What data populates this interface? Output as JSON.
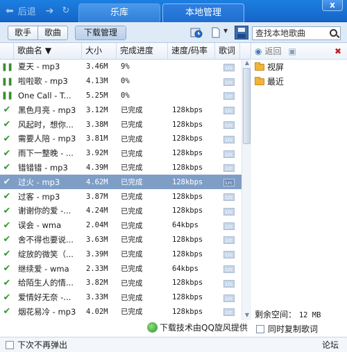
{
  "nav": {
    "back_label": "后退"
  },
  "tabs": [
    {
      "label": "乐库"
    },
    {
      "label": "本地管理"
    }
  ],
  "window": {
    "close_label": "x"
  },
  "toolbar": {
    "singer_label": "歌手",
    "song_label": "歌曲",
    "download_label": "下载管理",
    "search_placeholder": "查找本地歌曲"
  },
  "table": {
    "headers": {
      "name": "歌曲名 ▼",
      "size": "大小",
      "progress": "完成进度",
      "speed": "速度/码率",
      "lyric": "歌词"
    },
    "rows": [
      {
        "status": "pause",
        "name": "夏天 - mp3",
        "size": "3.46M",
        "progress": "9%",
        "speed": "",
        "lyric": "Lrc"
      },
      {
        "status": "pause",
        "name": "啦啦歌 - mp3",
        "size": "4.13M",
        "progress": "0%",
        "speed": "",
        "lyric": "Lrc"
      },
      {
        "status": "pause",
        "name": "One Call - T...",
        "size": "5.25M",
        "progress": "0%",
        "speed": "",
        "lyric": "Lrc"
      },
      {
        "status": "done",
        "name": "黑色月亮 - mp3",
        "size": "3.12M",
        "progress": "已完成",
        "speed": "128kbps",
        "lyric": "Lrc"
      },
      {
        "status": "done",
        "name": "风起时，想你...",
        "size": "3.38M",
        "progress": "已完成",
        "speed": "128kbps",
        "lyric": "Lrc"
      },
      {
        "status": "done",
        "name": "需要人陪 - mp3",
        "size": "3.81M",
        "progress": "已完成",
        "speed": "128kbps",
        "lyric": "Lrc"
      },
      {
        "status": "done",
        "name": "雨下一整晚 - ...",
        "size": "3.92M",
        "progress": "已完成",
        "speed": "128kbps",
        "lyric": "Lrc"
      },
      {
        "status": "done",
        "name": "错错错 - mp3",
        "size": "4.39M",
        "progress": "已完成",
        "speed": "128kbps",
        "lyric": "Lrc"
      },
      {
        "status": "done",
        "name": "过火 - mp3",
        "size": "4.62M",
        "progress": "已完成",
        "speed": "128kbps",
        "lyric": "Lrc",
        "selected": true
      },
      {
        "status": "done",
        "name": "过客 - mp3",
        "size": "3.87M",
        "progress": "已完成",
        "speed": "128kbps",
        "lyric": "Lrc"
      },
      {
        "status": "done",
        "name": "谢谢你的爱 -...",
        "size": "4.24M",
        "progress": "已完成",
        "speed": "128kbps",
        "lyric": "Lrc"
      },
      {
        "status": "done",
        "name": "误会 - wma",
        "size": "2.04M",
        "progress": "已完成",
        "speed": "64kbps",
        "lyric": "Lrc"
      },
      {
        "status": "done",
        "name": "舍不得也要说...",
        "size": "3.63M",
        "progress": "已完成",
        "speed": "128kbps",
        "lyric": "Lrc"
      },
      {
        "status": "done",
        "name": "绽放的微笑（...",
        "size": "3.39M",
        "progress": "已完成",
        "speed": "128kbps",
        "lyric": "Lrc"
      },
      {
        "status": "done",
        "name": "继续爱 - wma",
        "size": "2.33M",
        "progress": "已完成",
        "speed": "64kbps",
        "lyric": "Lrc"
      },
      {
        "status": "done",
        "name": "给陌生人的情...",
        "size": "3.82M",
        "progress": "已完成",
        "speed": "128kbps",
        "lyric": "Lrc"
      },
      {
        "status": "done",
        "name": "爱情好无奈 -...",
        "size": "3.33M",
        "progress": "已完成",
        "speed": "128kbps",
        "lyric": "Lrc"
      },
      {
        "status": "done",
        "name": "烟花易冷 - mp3",
        "size": "4.02M",
        "progress": "已完成",
        "speed": "128kbps",
        "lyric": "Lrc"
      }
    ]
  },
  "right_panel": {
    "back_label": "返回",
    "folders": [
      {
        "label": "视屏"
      },
      {
        "label": "最近"
      }
    ],
    "space_label": "剩余空间：",
    "space_value": "12 MB",
    "copy_lyrics_label": "同时复制歌词"
  },
  "notice": {
    "tech_text": "下载技术由QQ旋风提供"
  },
  "footer": {
    "dont_show_label": "下次不再弹出",
    "forum_label": "论坛"
  }
}
